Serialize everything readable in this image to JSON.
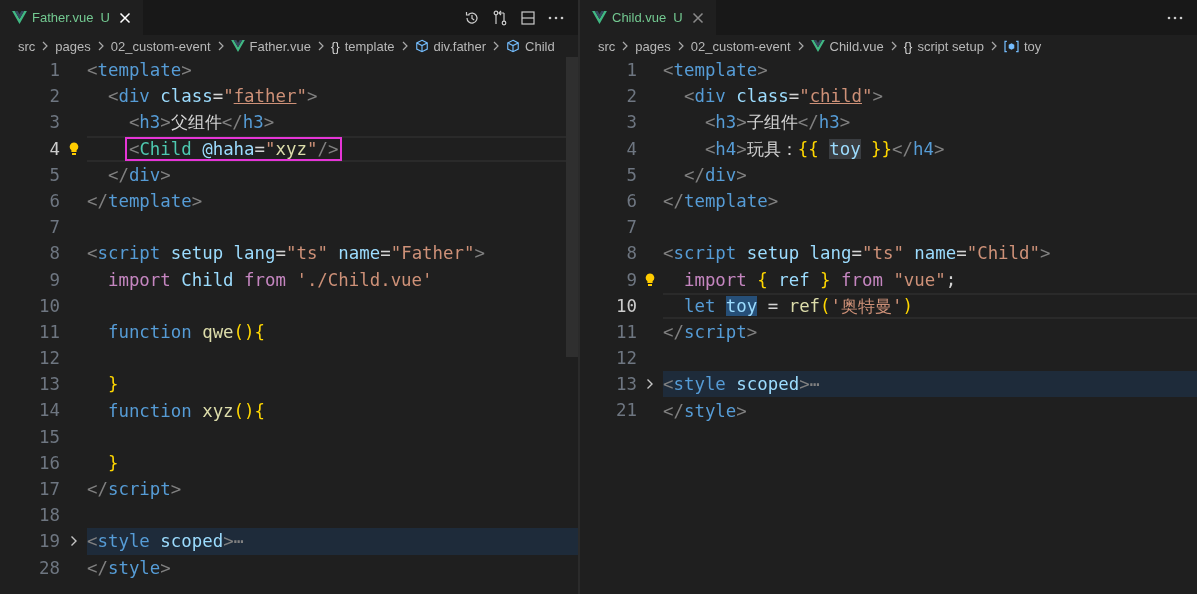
{
  "panes": [
    {
      "tab": {
        "title": "Father.vue",
        "status": "U",
        "focused": true
      },
      "breadcrumbs": [
        {
          "text": "src",
          "kind": "folder"
        },
        {
          "text": "pages",
          "kind": "folder"
        },
        {
          "text": "02_custom-event",
          "kind": "folder"
        },
        {
          "text": "Father.vue",
          "kind": "file"
        },
        {
          "text": "template",
          "kind": "section",
          "symbol": "{}"
        },
        {
          "text": "div.father",
          "kind": "element"
        },
        {
          "text": "Child",
          "kind": "element"
        }
      ],
      "lines": [
        {
          "number": "1",
          "current": false,
          "folded": false,
          "lightbulb": false,
          "tokens": [
            {
              "text": "<",
              "kind": "punct"
            },
            {
              "text": "template",
              "kind": "tag"
            },
            {
              "text": ">",
              "kind": "punct"
            }
          ]
        },
        {
          "number": "2",
          "current": false,
          "folded": false,
          "lightbulb": false,
          "tokens": [
            {
              "text": "  <",
              "kind": "punct"
            },
            {
              "text": "div",
              "kind": "tag"
            },
            {
              "text": " class",
              "kind": "attr"
            },
            {
              "text": "=",
              "kind": "plain"
            },
            {
              "text": "\"",
              "kind": "string"
            },
            {
              "text": "father",
              "kind": "class-name"
            },
            {
              "text": "\"",
              "kind": "string"
            },
            {
              "text": ">",
              "kind": "punct"
            }
          ]
        },
        {
          "number": "3",
          "current": false,
          "folded": false,
          "lightbulb": false,
          "tokens": [
            {
              "text": "    <",
              "kind": "punct"
            },
            {
              "text": "h3",
              "kind": "tag"
            },
            {
              "text": ">",
              "kind": "punct"
            },
            {
              "text": "父组件",
              "kind": "plain"
            },
            {
              "text": "</",
              "kind": "punct"
            },
            {
              "text": "h3",
              "kind": "tag"
            },
            {
              "text": ">",
              "kind": "punct"
            }
          ]
        },
        {
          "number": "4",
          "current": true,
          "folded": false,
          "lightbulb": true,
          "tokens": [
            {
              "kind": "box",
              "tokens": [
                {
                  "text": "    <",
                  "kind": "punct"
                },
                {
                  "text": "Child",
                  "kind": "component"
                },
                {
                  "text": " @haha",
                  "kind": "attr"
                },
                {
                  "text": "=",
                  "kind": "plain"
                },
                {
                  "text": "\"",
                  "kind": "string"
                },
                {
                  "text": "xyz",
                  "kind": "function"
                },
                {
                  "text": "\"",
                  "kind": "string"
                },
                {
                  "text": "/>",
                  "kind": "punct"
                }
              ]
            }
          ]
        },
        {
          "number": "5",
          "current": false,
          "folded": false,
          "lightbulb": false,
          "tokens": [
            {
              "text": "  </",
              "kind": "punct"
            },
            {
              "text": "div",
              "kind": "tag"
            },
            {
              "text": ">",
              "kind": "punct"
            }
          ]
        },
        {
          "number": "6",
          "current": false,
          "folded": false,
          "lightbulb": false,
          "tokens": [
            {
              "text": "</",
              "kind": "punct"
            },
            {
              "text": "template",
              "kind": "tag"
            },
            {
              "text": ">",
              "kind": "punct"
            }
          ]
        },
        {
          "number": "7",
          "current": false,
          "folded": false,
          "lightbulb": false
        },
        {
          "number": "8",
          "current": false,
          "folded": false,
          "lightbulb": false,
          "tokens": [
            {
              "text": "<",
              "kind": "punct"
            },
            {
              "text": "script",
              "kind": "tag"
            },
            {
              "text": " setup lang",
              "kind": "attr"
            },
            {
              "text": "=",
              "kind": "plain"
            },
            {
              "text": "\"ts\"",
              "kind": "string"
            },
            {
              "text": " name",
              "kind": "attr"
            },
            {
              "text": "=",
              "kind": "plain"
            },
            {
              "text": "\"Father\"",
              "kind": "string"
            },
            {
              "text": ">",
              "kind": "punct"
            }
          ]
        },
        {
          "number": "9",
          "current": false,
          "folded": false,
          "lightbulb": false,
          "tokens": [
            {
              "text": "  import",
              "kind": "keyword"
            },
            {
              "text": " Child",
              "kind": "variable"
            },
            {
              "text": " from",
              "kind": "keyword"
            },
            {
              "text": " './Child.vue'",
              "kind": "string"
            }
          ]
        },
        {
          "number": "10",
          "current": false,
          "folded": false,
          "lightbulb": false
        },
        {
          "number": "11",
          "current": false,
          "folded": false,
          "lightbulb": false,
          "tokens": [
            {
              "text": "  function",
              "kind": "storage"
            },
            {
              "text": " qwe",
              "kind": "function"
            },
            {
              "text": "(){",
              "kind": "bracket"
            }
          ]
        },
        {
          "number": "12",
          "current": false,
          "folded": false,
          "lightbulb": false
        },
        {
          "number": "13",
          "current": false,
          "folded": false,
          "lightbulb": false,
          "tokens": [
            {
              "text": "  }",
              "kind": "bracket"
            }
          ]
        },
        {
          "number": "14",
          "current": false,
          "folded": false,
          "lightbulb": false,
          "tokens": [
            {
              "text": "  function",
              "kind": "storage"
            },
            {
              "text": " xyz",
              "kind": "function"
            },
            {
              "text": "(){",
              "kind": "bracket"
            }
          ]
        },
        {
          "number": "15",
          "current": false,
          "folded": false,
          "lightbulb": false
        },
        {
          "number": "16",
          "current": false,
          "folded": false,
          "lightbulb": false,
          "tokens": [
            {
              "text": "  }",
              "kind": "bracket"
            }
          ]
        },
        {
          "number": "17",
          "current": false,
          "folded": false,
          "lightbulb": false,
          "tokens": [
            {
              "text": "</",
              "kind": "punct"
            },
            {
              "text": "script",
              "kind": "tag"
            },
            {
              "text": ">",
              "kind": "punct"
            }
          ]
        },
        {
          "number": "18",
          "current": false,
          "folded": false,
          "lightbulb": false
        },
        {
          "number": "19",
          "current": false,
          "folded": true,
          "lightbulb": false,
          "tokens": [
            {
              "text": "<",
              "kind": "punct"
            },
            {
              "text": "style",
              "kind": "tag"
            },
            {
              "text": " scoped",
              "kind": "attr"
            },
            {
              "text": ">⋯",
              "kind": "punct"
            }
          ]
        },
        {
          "number": "28",
          "current": false,
          "folded": false,
          "lightbulb": false,
          "tokens": [
            {
              "text": "</",
              "kind": "punct"
            },
            {
              "text": "style",
              "kind": "tag"
            },
            {
              "text": ">",
              "kind": "punct"
            }
          ]
        }
      ]
    },
    {
      "tab": {
        "title": "Child.vue",
        "status": "U",
        "focused": false
      },
      "breadcrumbs": [
        {
          "text": "src",
          "kind": "folder"
        },
        {
          "text": "pages",
          "kind": "folder"
        },
        {
          "text": "02_custom-event",
          "kind": "folder"
        },
        {
          "text": "Child.vue",
          "kind": "file"
        },
        {
          "text": "script setup",
          "kind": "section",
          "symbol": "{}"
        },
        {
          "text": "toy",
          "kind": "variable"
        }
      ],
      "lines": [
        {
          "number": "1",
          "current": false,
          "folded": false,
          "lightbulb": false,
          "tokens": [
            {
              "text": "<",
              "kind": "punct"
            },
            {
              "text": "template",
              "kind": "tag"
            },
            {
              "text": ">",
              "kind": "punct"
            }
          ]
        },
        {
          "number": "2",
          "current": false,
          "folded": false,
          "lightbulb": false,
          "tokens": [
            {
              "text": "  <",
              "kind": "punct"
            },
            {
              "text": "div",
              "kind": "tag"
            },
            {
              "text": " class",
              "kind": "attr"
            },
            {
              "text": "=",
              "kind": "plain"
            },
            {
              "text": "\"",
              "kind": "string"
            },
            {
              "text": "child",
              "kind": "class-name"
            },
            {
              "text": "\"",
              "kind": "string"
            },
            {
              "text": ">",
              "kind": "punct"
            }
          ]
        },
        {
          "number": "3",
          "current": false,
          "folded": false,
          "lightbulb": false,
          "tokens": [
            {
              "text": "    <",
              "kind": "punct"
            },
            {
              "text": "h3",
              "kind": "tag"
            },
            {
              "text": ">",
              "kind": "punct"
            },
            {
              "text": "子组件",
              "kind": "plain"
            },
            {
              "text": "</",
              "kind": "punct"
            },
            {
              "text": "h3",
              "kind": "tag"
            },
            {
              "text": ">",
              "kind": "punct"
            }
          ]
        },
        {
          "number": "4",
          "current": false,
          "folded": false,
          "lightbulb": false,
          "tokens": [
            {
              "text": "    <",
              "kind": "punct"
            },
            {
              "text": "h4",
              "kind": "tag"
            },
            {
              "text": ">",
              "kind": "punct"
            },
            {
              "text": "玩具：",
              "kind": "plain"
            },
            {
              "text": "{{ ",
              "kind": "bracket"
            },
            {
              "text": "toy",
              "kind": "variable",
              "highlighted": true
            },
            {
              "text": " }}",
              "kind": "bracket"
            },
            {
              "text": "</",
              "kind": "punct"
            },
            {
              "text": "h4",
              "kind": "tag"
            },
            {
              "text": ">",
              "kind": "punct"
            }
          ]
        },
        {
          "number": "5",
          "current": false,
          "folded": false,
          "lightbulb": false,
          "tokens": [
            {
              "text": "  </",
              "kind": "punct"
            },
            {
              "text": "div",
              "kind": "tag"
            },
            {
              "text": ">",
              "kind": "punct"
            }
          ]
        },
        {
          "number": "6",
          "current": false,
          "folded": false,
          "lightbulb": false,
          "tokens": [
            {
              "text": "</",
              "kind": "punct"
            },
            {
              "text": "template",
              "kind": "tag"
            },
            {
              "text": ">",
              "kind": "punct"
            }
          ]
        },
        {
          "number": "7",
          "current": false,
          "folded": false,
          "lightbulb": false
        },
        {
          "number": "8",
          "current": false,
          "folded": false,
          "lightbulb": false,
          "tokens": [
            {
              "text": "<",
              "kind": "punct"
            },
            {
              "text": "script",
              "kind": "tag"
            },
            {
              "text": " setup lang",
              "kind": "attr"
            },
            {
              "text": "=",
              "kind": "plain"
            },
            {
              "text": "\"ts\"",
              "kind": "string"
            },
            {
              "text": " name",
              "kind": "attr"
            },
            {
              "text": "=",
              "kind": "plain"
            },
            {
              "text": "\"Child\"",
              "kind": "string"
            },
            {
              "text": ">",
              "kind": "punct"
            }
          ]
        },
        {
          "number": "9",
          "current": false,
          "folded": false,
          "lightbulb": true,
          "tokens": [
            {
              "text": "  import",
              "kind": "keyword"
            },
            {
              "text": " {",
              "kind": "bracket"
            },
            {
              "text": " ref",
              "kind": "variable"
            },
            {
              "text": " }",
              "kind": "bracket"
            },
            {
              "text": " from",
              "kind": "keyword"
            },
            {
              "text": " \"vue\"",
              "kind": "string"
            },
            {
              "text": ";",
              "kind": "plain"
            }
          ]
        },
        {
          "number": "10",
          "current": true,
          "folded": false,
          "lightbulb": false,
          "tokens": [
            {
              "text": "  let ",
              "kind": "storage"
            },
            {
              "text": "toy",
              "kind": "variable",
              "highlighted": true
            },
            {
              "text": " = ",
              "kind": "plain"
            },
            {
              "text": "ref",
              "kind": "function"
            },
            {
              "text": "(",
              "kind": "bracket"
            },
            {
              "text": "'奥特曼'",
              "kind": "string"
            },
            {
              "text": ")",
              "kind": "bracket"
            }
          ]
        },
        {
          "number": "11",
          "current": false,
          "folded": false,
          "lightbulb": false,
          "tokens": [
            {
              "text": "</",
              "kind": "punct"
            },
            {
              "text": "script",
              "kind": "tag"
            },
            {
              "text": ">",
              "kind": "punct"
            }
          ]
        },
        {
          "number": "12",
          "current": false,
          "folded": false,
          "lightbulb": false
        },
        {
          "number": "13",
          "current": false,
          "folded": true,
          "lightbulb": false,
          "tokens": [
            {
              "text": "<",
              "kind": "punct"
            },
            {
              "text": "style",
              "kind": "tag"
            },
            {
              "text": " scoped",
              "kind": "attr"
            },
            {
              "text": ">⋯",
              "kind": "punct"
            }
          ]
        },
        {
          "number": "21",
          "current": false,
          "folded": false,
          "lightbulb": false,
          "tokens": [
            {
              "text": "</",
              "kind": "punct"
            },
            {
              "text": "style",
              "kind": "tag"
            },
            {
              "text": ">",
              "kind": "punct"
            }
          ]
        }
      ]
    }
  ]
}
